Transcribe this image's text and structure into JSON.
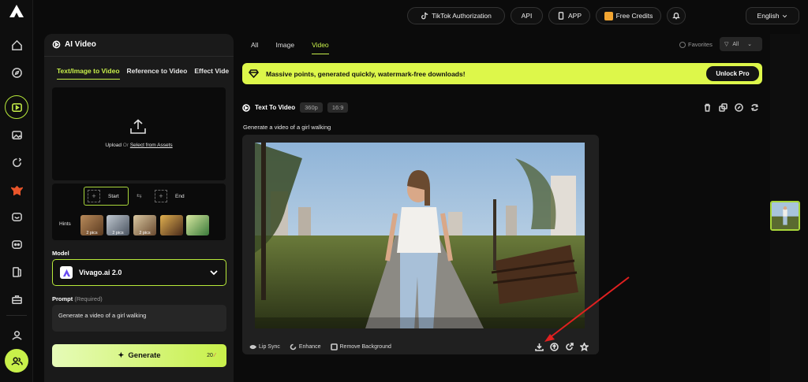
{
  "rail": {
    "items": [
      "home-icon",
      "compass-icon",
      "video-icon",
      "image-icon",
      "enhance-icon",
      "character-icon",
      "chat-icon",
      "game-icon",
      "cards-icon",
      "toolbox-icon",
      "profile-icon",
      "community-icon"
    ]
  },
  "topbar": {
    "tiktok": "TikTok Authorization",
    "api": "API",
    "app": "APP",
    "credits": "Free Credits",
    "language": "English"
  },
  "panel": {
    "title": "AI Video",
    "tabs": [
      "Text/Image to Video",
      "Reference to Video",
      "Effect Vide"
    ],
    "upload_label": "Upload",
    "upload_or": "Or",
    "upload_assets": "Select from Assets",
    "start_label": "Start",
    "end_label": "End",
    "hints_label": "Hints",
    "hint_thumbs": [
      "2 pics",
      "2 pics",
      "2 pics",
      "",
      ""
    ],
    "model_label": "Model",
    "model_name": "Vivago.ai 2.0",
    "prompt_label": "Prompt",
    "prompt_required": "(Required)",
    "prompt_value": "Generate a video of a girl walking",
    "generate_label": "Generate",
    "generate_cost": "20"
  },
  "main": {
    "tabs": [
      "All",
      "Image",
      "Video"
    ],
    "favorites": "Favorites",
    "filter": "All",
    "banner_text": "Massive points, generated quickly, watermark-free downloads!",
    "unlock": "Unlock Pro",
    "mode": "Text To Video",
    "resolution": "360p",
    "ratio": "16:9",
    "prompt_text": "Generate a video of a girl walking",
    "tools": [
      "Lip Sync",
      "Enhance",
      "Remove Background"
    ]
  },
  "colors": {
    "accent": "#c8f04a",
    "banner": "#ddf74a",
    "bg": "#0b0b0b",
    "panel": "#1a1a1a"
  }
}
